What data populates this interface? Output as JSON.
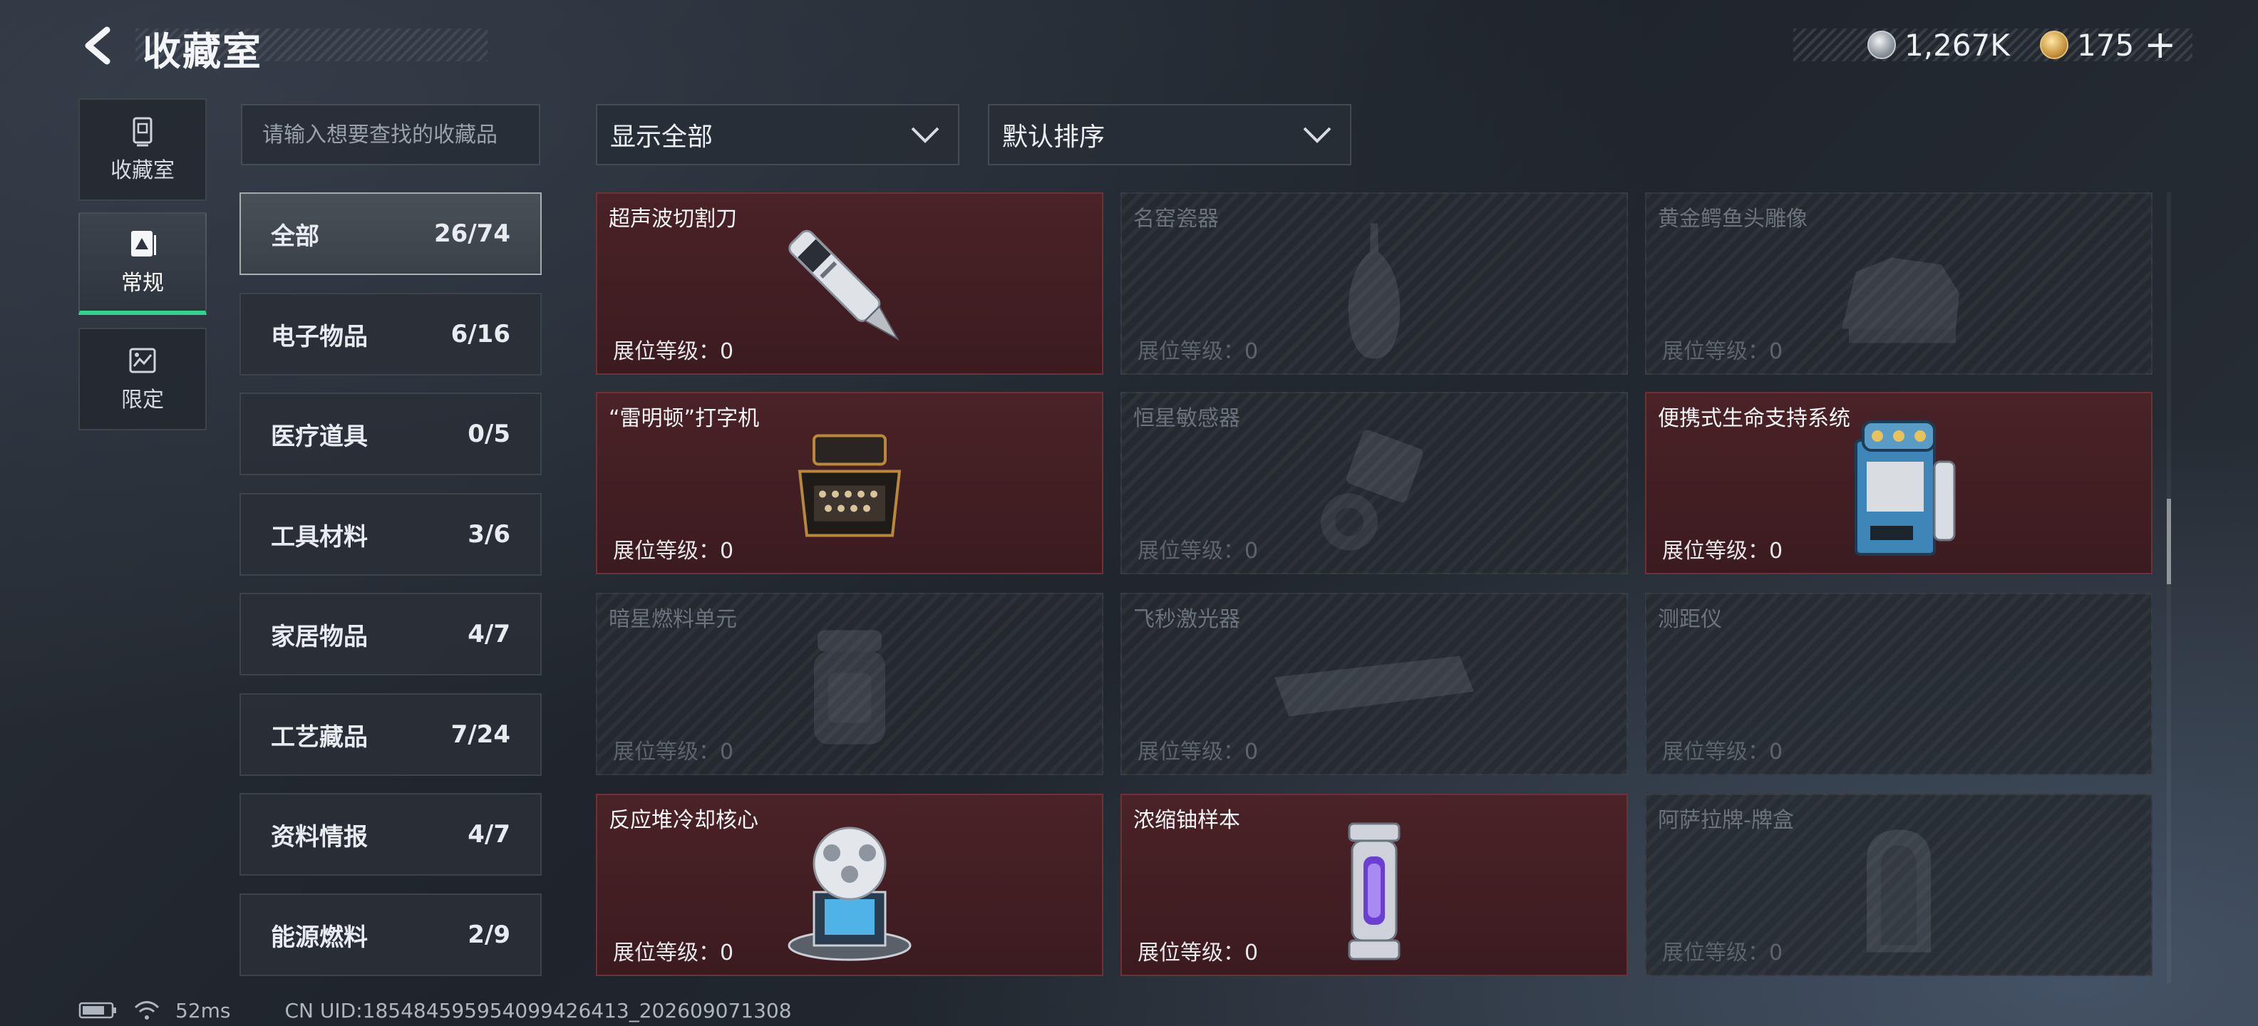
{
  "header": {
    "title": "收藏室",
    "currencies": [
      {
        "icon": "silver-coin-icon",
        "value": "1,267K"
      },
      {
        "icon": "gold-coin-icon",
        "value": "175"
      }
    ],
    "add_label": "+"
  },
  "nav": {
    "items": [
      {
        "label": "收藏室",
        "icon": "collection-room-icon"
      },
      {
        "label": "常规",
        "icon": "regular-icon",
        "active": true
      },
      {
        "label": "限定",
        "icon": "limited-icon"
      }
    ]
  },
  "search": {
    "placeholder": "请输入想要查找的收藏品"
  },
  "filters": {
    "show_all": "显示全部",
    "sort": "默认排序"
  },
  "categories": [
    {
      "name": "全部",
      "count": "26/74"
    },
    {
      "name": "电子物品",
      "count": "6/16"
    },
    {
      "name": "医疗道具",
      "count": "0/5"
    },
    {
      "name": "工具材料",
      "count": "3/6"
    },
    {
      "name": "家居物品",
      "count": "4/7"
    },
    {
      "name": "工艺藏品",
      "count": "7/24"
    },
    {
      "name": "资料情报",
      "count": "4/7"
    },
    {
      "name": "能源燃料",
      "count": "2/9"
    }
  ],
  "items": [
    {
      "name": "超声波切割刀",
      "level": "展位等级：0",
      "owned": true,
      "icon": "ultrasonic-cutter-icon"
    },
    {
      "name": "名窑瓷器",
      "level": "展位等级：0",
      "owned": false,
      "icon": "porcelain-vase-icon"
    },
    {
      "name": "黄金鳄鱼头雕像",
      "level": "展位等级：0",
      "owned": false,
      "icon": "gold-crocodile-statue-icon"
    },
    {
      "name": "“雷明顿”打字机",
      "level": "展位等级：0",
      "owned": true,
      "icon": "typewriter-icon"
    },
    {
      "name": "恒星敏感器",
      "level": "展位等级：0",
      "owned": false,
      "icon": "star-sensor-icon"
    },
    {
      "name": "便携式生命支持系统",
      "level": "展位等级：0",
      "owned": true,
      "icon": "life-support-system-icon"
    },
    {
      "name": "暗星燃料单元",
      "level": "展位等级：0",
      "owned": false,
      "icon": "fuel-cell-icon"
    },
    {
      "name": "飞秒激光器",
      "level": "展位等级：0",
      "owned": false,
      "icon": "femtosecond-laser-icon"
    },
    {
      "name": "测距仪",
      "level": "展位等级：0",
      "owned": false,
      "icon": "rangefinder-icon"
    },
    {
      "name": "反应堆冷却核心",
      "level": "展位等级：0",
      "owned": true,
      "icon": "reactor-core-icon"
    },
    {
      "name": "浓缩铀样本",
      "level": "展位等级：0",
      "owned": true,
      "icon": "uranium-sample-icon"
    },
    {
      "name": "阿萨拉牌-牌盒",
      "level": "展位等级：0",
      "owned": false,
      "icon": "card-box-icon"
    }
  ],
  "footer": {
    "ping": "52ms",
    "uid": "CN UID:18548459595409942641​3_202609071308"
  }
}
